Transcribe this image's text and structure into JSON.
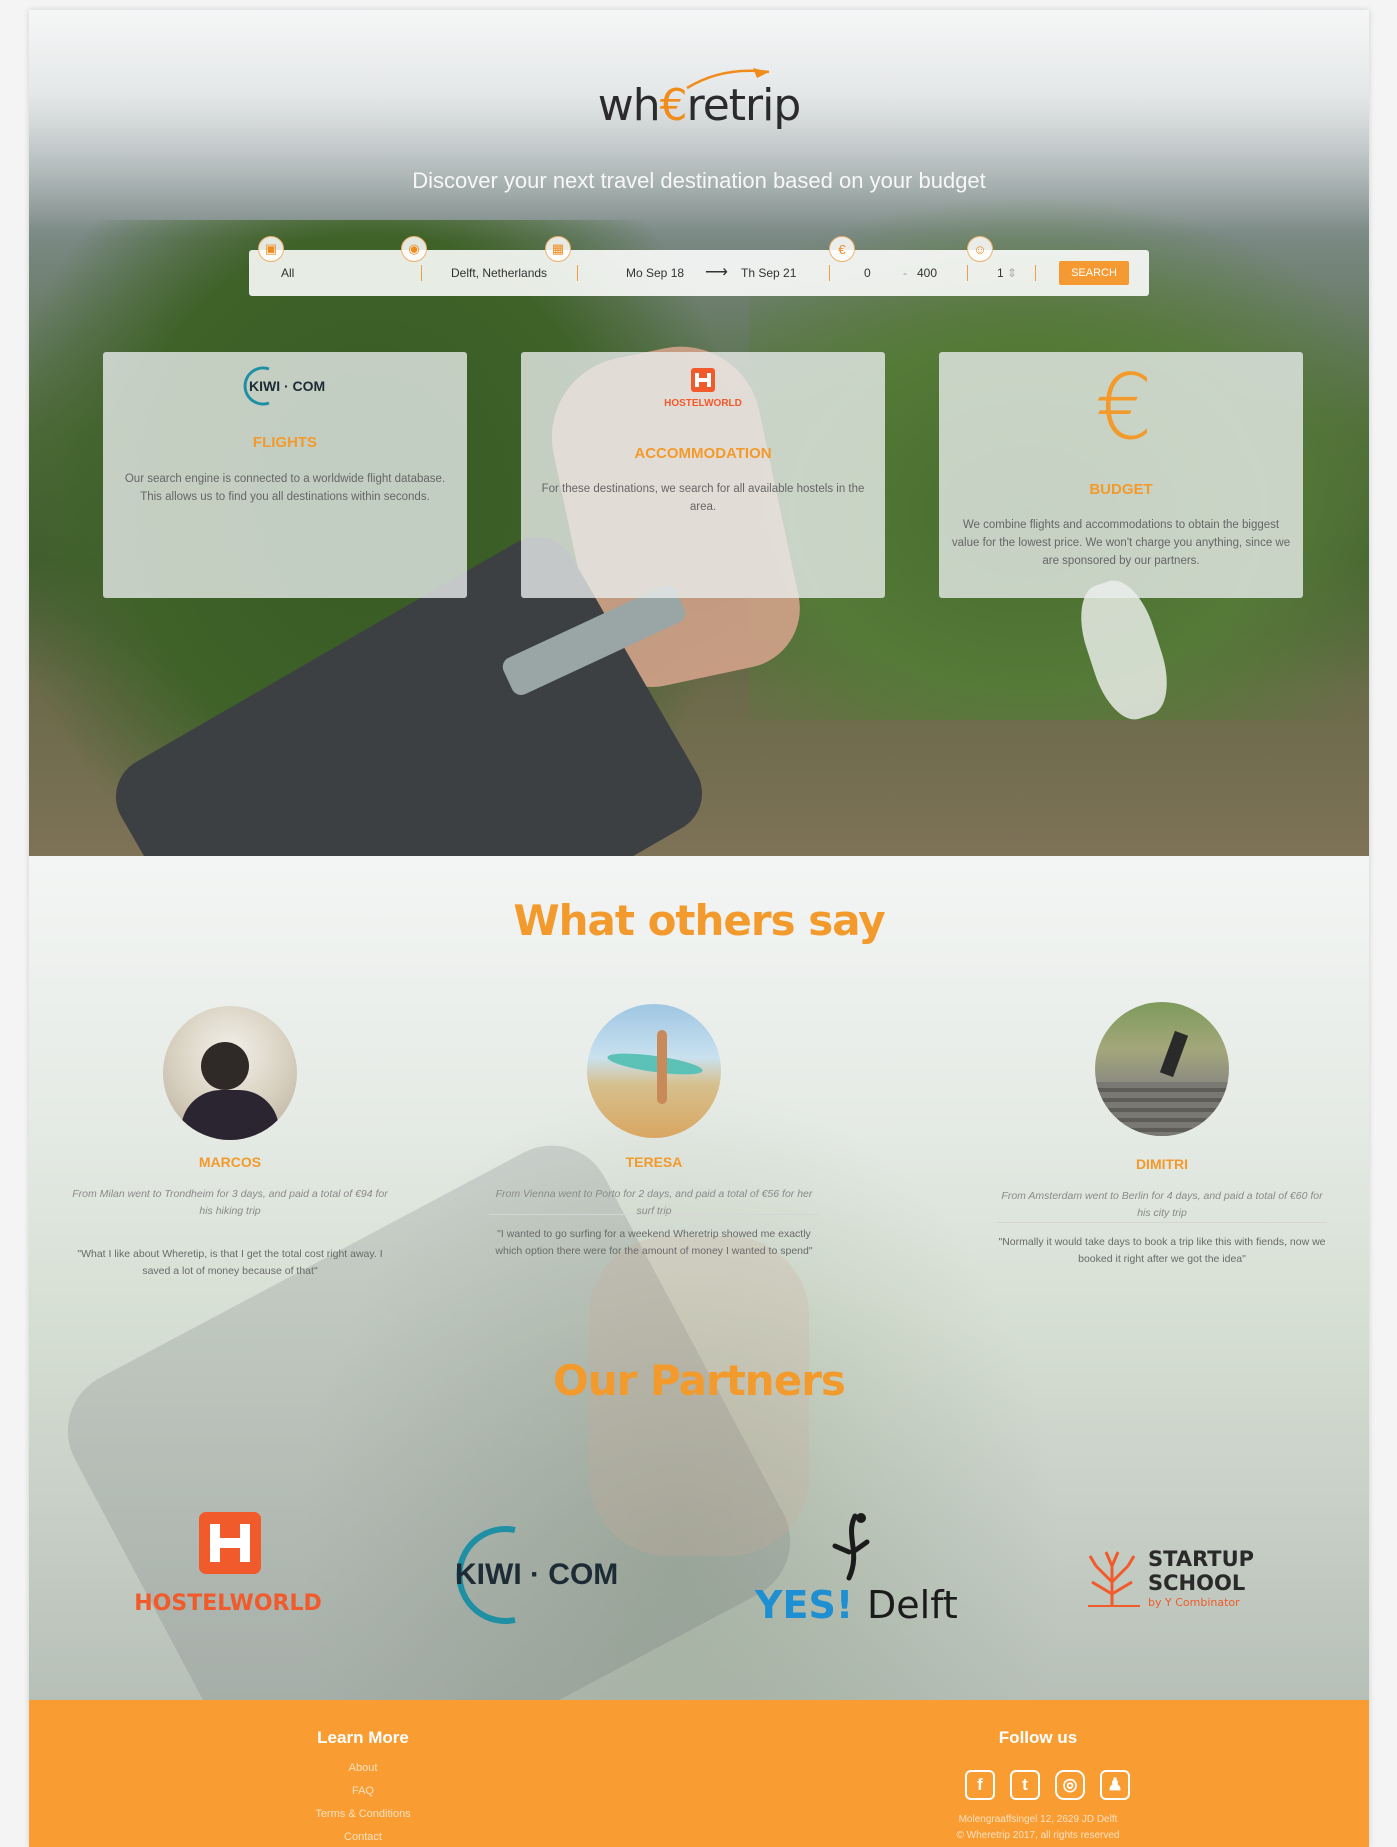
{
  "brand": {
    "logo_prefix": "wh",
    "logo_accent": "€",
    "logo_suffix": "retrip",
    "accent_color": "#f39a2d"
  },
  "hero": {
    "tagline": "Discover your next travel destination based on your budget"
  },
  "search": {
    "type_value": "All",
    "origin_value": "Delft, Netherlands",
    "depart_date": "Mo Sep 18",
    "arrow": "⟶",
    "return_date": "Th Sep 21",
    "budget_min": "0",
    "budget_dash": "-",
    "budget_max": "400",
    "travellers": "1",
    "button_label": "SEARCH",
    "icons": [
      "suitcase-icon",
      "location-pin-icon",
      "calendar-icon",
      "euro-icon",
      "person-icon"
    ]
  },
  "features": [
    {
      "logo": "KIWI · COM",
      "title": "FLIGHTS",
      "text": "Our search engine is connected to a worldwide flight database. This allows us to find you all destinations within seconds."
    },
    {
      "logo": "HOSTELWORLD",
      "title": "ACCOMMODATION",
      "text": "For these destinations, we search for all available hostels in the area."
    },
    {
      "logo": "€",
      "title": "BUDGET",
      "text": "We combine flights and accommodations to obtain the biggest value for the lowest price. We won't charge you anything, since we are sponsored by our partners."
    }
  ],
  "testimonials_title": "What others say",
  "testimonials": [
    {
      "name": "MARCOS",
      "trip": "From Milan went to Trondheim for 3 days, and paid a total of €94 for his hiking trip",
      "quote": "\"What I like about Wheretip, is that I get the total cost right away. I saved a lot of money because of that\""
    },
    {
      "name": "TERESA",
      "trip": "From Vienna went to Porto for 2 days, and paid a total of €56 for her surf trip",
      "quote": "\"I wanted to go surfing for a weekend Wheretrip showed me exactly which option there were for the amount of money I wanted to spend\""
    },
    {
      "name": "DIMITRI",
      "trip": "From Amsterdam went to Berlin for 4 days, and paid a total of €60 for his city trip",
      "quote": "\"Normally it would take days to book a trip like this with fiends, now we booked it right after we got the idea\""
    }
  ],
  "partners_title": "Our Partners",
  "partners": [
    {
      "name": "HOSTELWORLD"
    },
    {
      "name": "KIWI · COM"
    },
    {
      "name": "YESIDelft",
      "prefix": "YES!",
      "suffix": "Delft"
    },
    {
      "name": "STARTUP SCHOOL",
      "line1": "STARTUP",
      "line2": "SCHOOL",
      "line3": "by Y Combinator"
    }
  ],
  "footer": {
    "learn_more_title": "Learn More",
    "links": [
      "About",
      "FAQ",
      "Terms & Conditions",
      "Contact"
    ],
    "follow_title": "Follow us",
    "social": [
      "facebook-icon",
      "twitter-icon",
      "instagram-icon",
      "snapchat-icon"
    ],
    "address": "Molengraaffsingel 12, 2629 JD Delft",
    "copyright": "© Wheretrip 2017, all rights reserved"
  }
}
